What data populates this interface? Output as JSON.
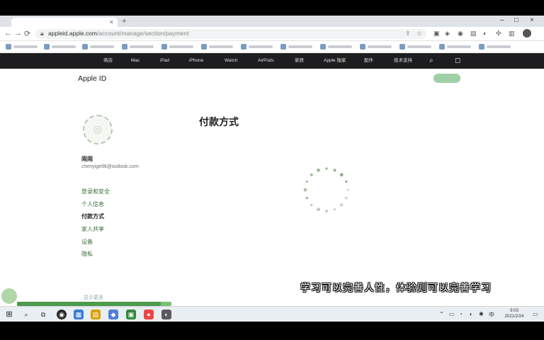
{
  "browser": {
    "tab": {
      "close_glyph": "×"
    },
    "new_tab_glyph": "+",
    "window_controls": [
      "–",
      "□",
      "×"
    ],
    "nav_buttons": [
      "←",
      "→",
      "⟳"
    ],
    "url_host": "appleid.apple.com",
    "url_path": "/account/manage/section/payment",
    "lock_icon": "lock-icon"
  },
  "gnav": {
    "apple_glyph": "",
    "items": [
      "商店",
      "Mac",
      "iPad",
      "iPhone",
      "Watch",
      "AirPods",
      "家居",
      "Apple 独家",
      "配件",
      "技术支持"
    ],
    "search_glyph": "⌕",
    "bag_glyph": "◻"
  },
  "header": {
    "title": "Apple ID"
  },
  "profile": {
    "avatar_glyph": "◎",
    "name": "闹闹",
    "email": "chenyige96@outlook.com"
  },
  "sidebar": {
    "items": [
      {
        "label": "登录和安全"
      },
      {
        "label": "个人信息"
      },
      {
        "label": "付款方式",
        "active": true
      },
      {
        "label": "家人共享"
      },
      {
        "label": "设备"
      },
      {
        "label": "隐私"
      }
    ]
  },
  "main": {
    "heading": "付款方式"
  },
  "footer": {
    "link": "显示更多"
  },
  "caption": {
    "text": "学习可以完善人性，体验则可以完善学习"
  },
  "progress": {
    "fraction": 0.93
  },
  "taskbar": {
    "start_glyph": "⊞",
    "clock_time": "9:03",
    "clock_date": "2021/2/24"
  },
  "colors": {
    "nav_bg": "#1d1d1f",
    "link": "#3a6e3a",
    "accent_button": "#9fcfa6"
  }
}
